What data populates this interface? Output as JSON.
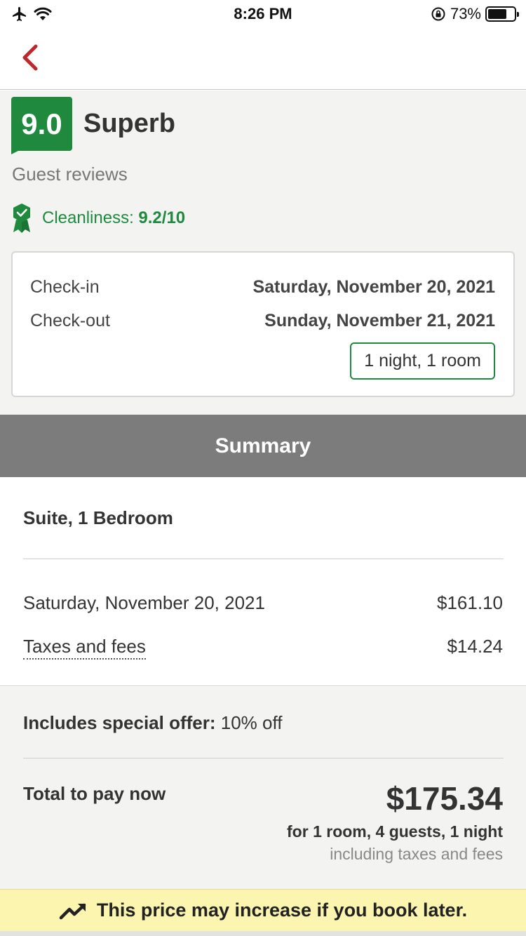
{
  "status_bar": {
    "time": "8:26 PM",
    "battery_percent": "73%",
    "battery_level": 0.73
  },
  "header": {
    "back_icon": "chevron-left-icon",
    "accent_color": "#c0272d"
  },
  "rating": {
    "score": "9.0",
    "word": "Superb",
    "subtitle": "Guest reviews",
    "badge_color": "#1f8a3e",
    "cleanliness_label": "Cleanliness:",
    "cleanliness_value": "9.2/10",
    "cleanliness_icon": "award-ribbon-icon"
  },
  "stay": {
    "checkin_label": "Check-in",
    "checkin_date": "Saturday, November 20, 2021",
    "checkout_label": "Check-out",
    "checkout_date": "Sunday, November 21, 2021",
    "nights_rooms": "1 night, 1 room"
  },
  "summary": {
    "title": "Summary",
    "room_type": "Suite, 1 Bedroom",
    "lines": [
      {
        "label": "Saturday, November 20, 2021",
        "value": "$161.10"
      },
      {
        "label": "Taxes and fees",
        "value": "$14.24"
      }
    ]
  },
  "offer": {
    "label": "Includes special offer:",
    "value": "10% off"
  },
  "total": {
    "label": "Total to pay now",
    "amount": "$175.34",
    "detail": "for 1 room, 4 guests, 1 night",
    "note": "including taxes and fees"
  },
  "banner": {
    "icon": "trending-up-icon",
    "text": "This price may increase if you book later.",
    "color": "#fcf5b0"
  }
}
